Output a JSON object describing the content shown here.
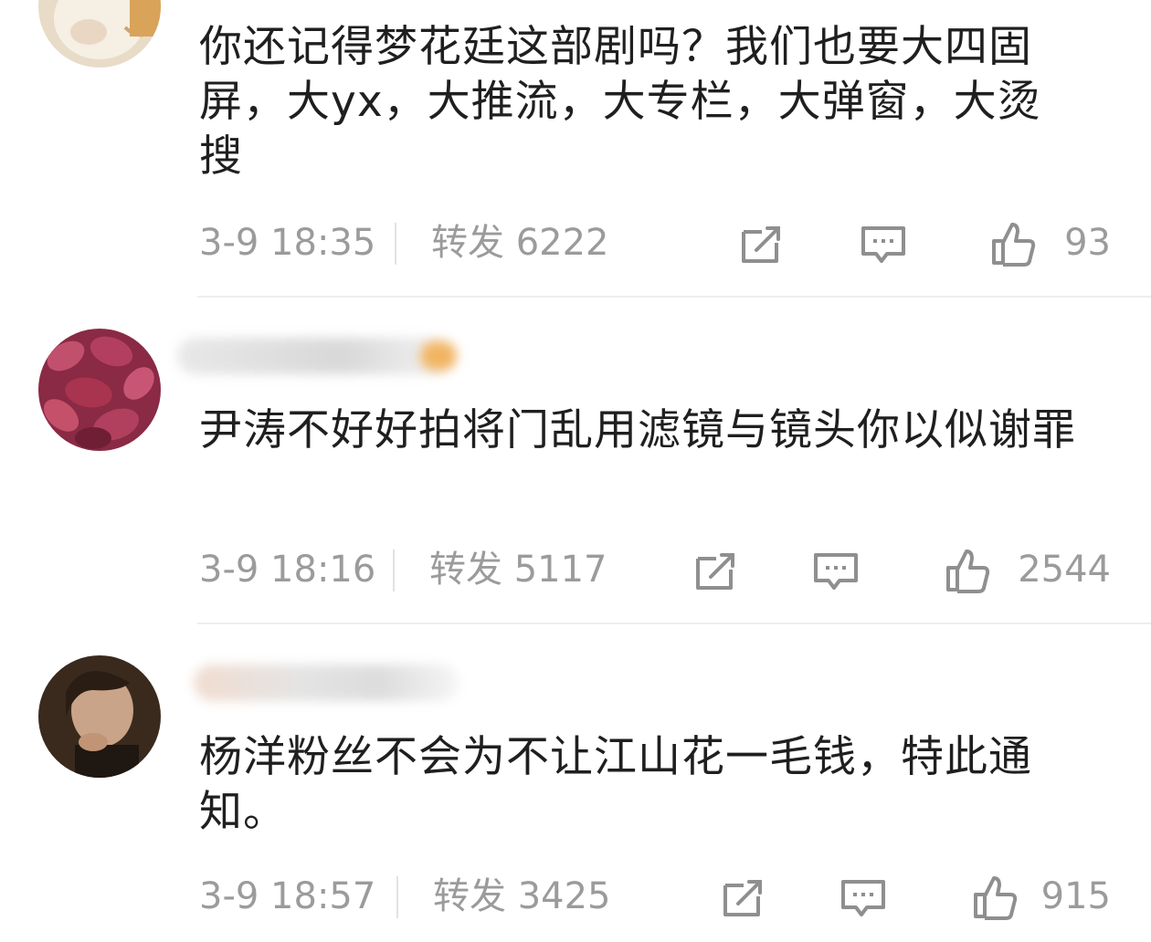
{
  "comments": [
    {
      "text": "你还记得梦花廷这部剧吗？我们也要大四固屏，大yx，大推流，大专栏，大弹窗，大烫搜",
      "time": "3-9 18:35",
      "repost": "转发 6222",
      "likes": "93"
    },
    {
      "text": "尹涛不好好拍将门乱用滤镜与镜头你以似谢罪",
      "time": "3-9 18:16",
      "repost": "转发 5117",
      "likes": "2544"
    },
    {
      "text": "杨洋粉丝不会为不让江山花一毛钱，特此通知。",
      "time": "3-9 18:57",
      "repost": "转发 3425",
      "likes": "915"
    }
  ],
  "icons": {
    "repost": "share-icon",
    "comment": "comment-icon",
    "like": "thumbs-up-icon"
  },
  "colors": {
    "text": "#1f1f1f",
    "meta": "#9b9b9b",
    "divider": "#eeeeee"
  }
}
